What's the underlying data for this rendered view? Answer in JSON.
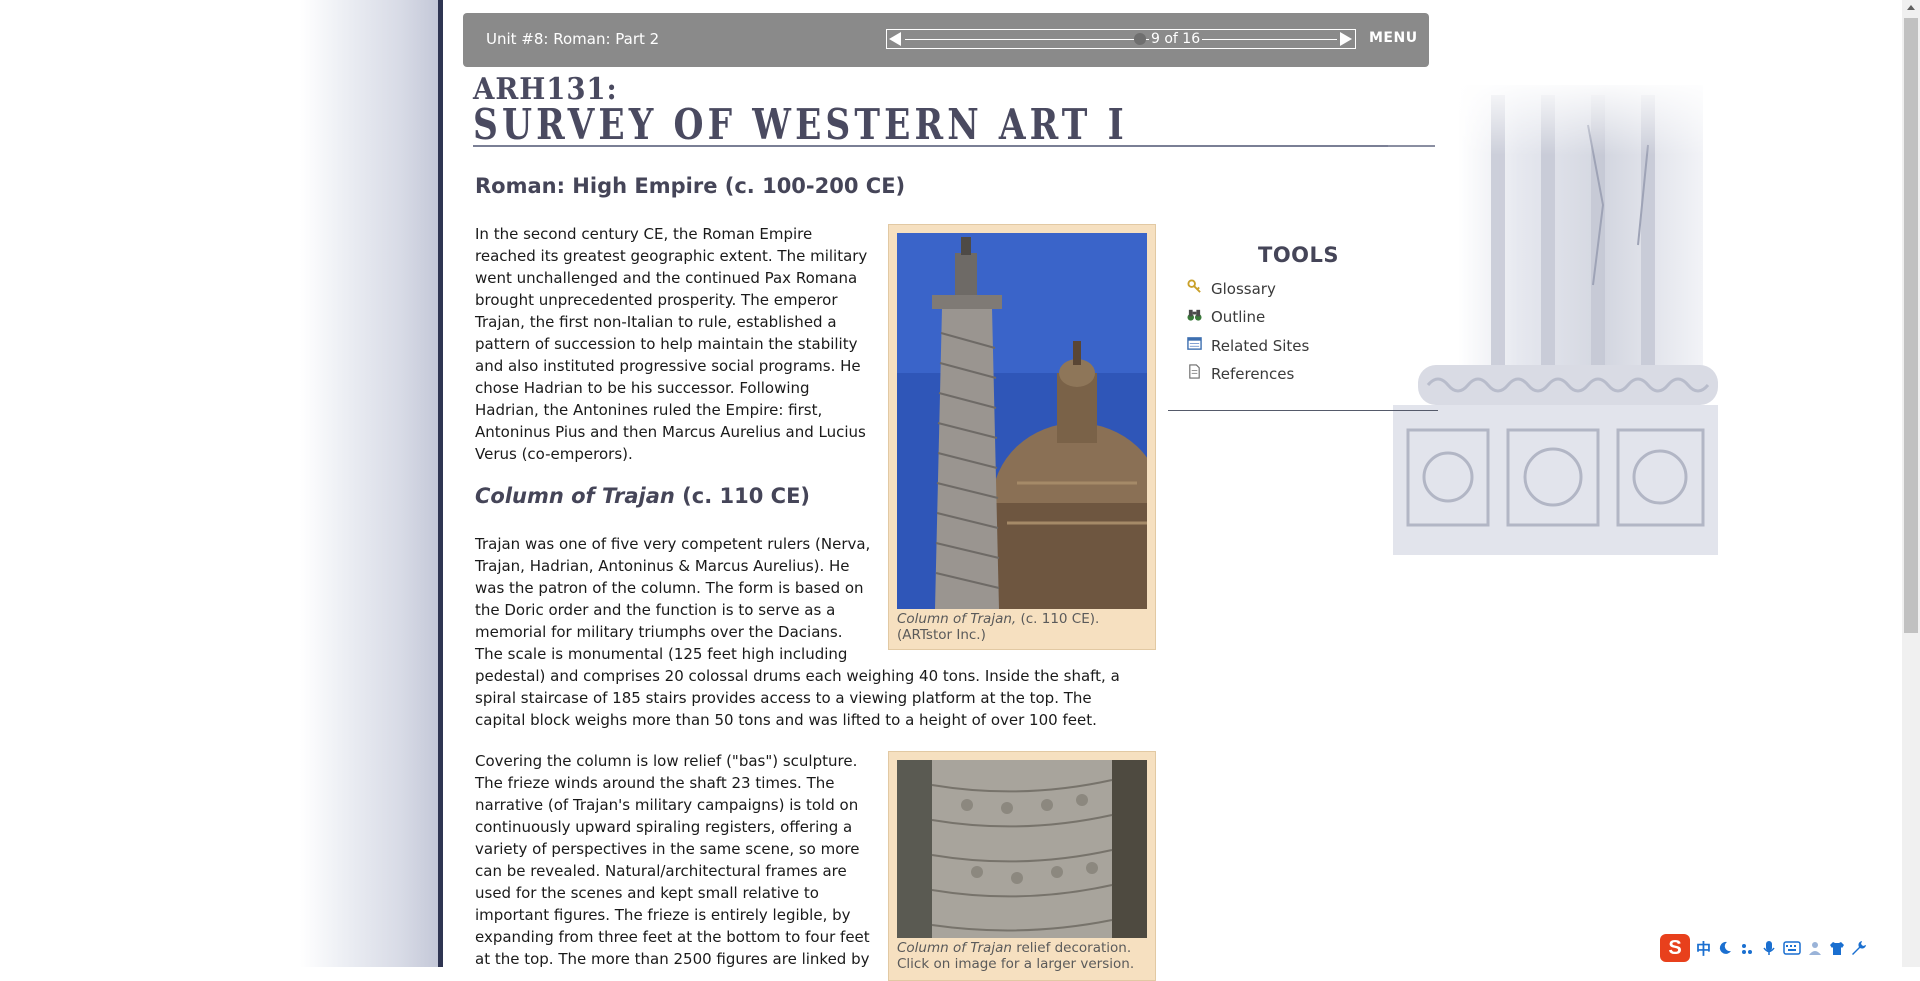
{
  "nav": {
    "unit_title": "Unit #8: Roman: Part 2",
    "pager_text": "9 of 16",
    "menu_label": "MENU"
  },
  "header": {
    "course_code": "ARH131:",
    "course_title": "SURVEY OF WESTERN ART I"
  },
  "main": {
    "section_heading": "Roman: High Empire (c. 100-200 CE)",
    "intro_paragraph": "In the second century CE, the Roman Empire reached its greatest geographic extent. The military went unchallenged and the continued Pax Romana brought unprecedented prosperity. The emperor Trajan, the first non-Italian to rule, established a pattern of succession to help maintain the stability and also instituted progressive social programs. He chose Hadrian to be his successor. Following Hadrian, the Antonines ruled the Empire: first, Antoninus Pius and then Marcus Aurelius and Lucius Verus (co-emperors).",
    "subheading_italic": "Column of Trajan",
    "subheading_rest": " (c. 110 CE)",
    "paragraph_2a": "Trajan was one of five very competent rulers (Nerva, Trajan, Hadrian, Antoninus & Marcus Aurelius). He was the patron of the column. The form is based on the Doric order and the function is to serve as a memorial for military triumphs over the Dacians. The scale is monumental (125 feet high including",
    "paragraph_2b": "pedestal) and comprises 20 colossal drums each weighing 40 tons. Inside the shaft, a spiral staircase of 185 stairs provides access to a viewing platform at the top. The capital block weighs more than 50 tons and was lifted to a height of over 100 feet.",
    "paragraph_3": "Covering the column is low relief (\"bas\") sculpture. The frieze winds around the shaft 23 times. The narrative (of Trajan's military campaigns) is told on continuously upward spiraling registers, offering a variety of perspectives in the same scene, so more can be revealed. Natural/architectural frames are used for the scenes and kept small relative to important figures. The frieze is entirely legible, by expanding from three feet at the bottom to four feet at the top. The more than 2500 figures are linked by"
  },
  "figures": [
    {
      "caption_italic": "Column of Trajan,",
      "caption_rest": " (c. 110 CE). (ARTstor Inc.)"
    },
    {
      "caption_italic": "Column of Trajan",
      "caption_rest": " relief decoration. Click on image for a larger version."
    }
  ],
  "tools": {
    "title": "TOOLS",
    "items": [
      {
        "label": "Glossary",
        "icon": "key-icon"
      },
      {
        "label": "Outline",
        "icon": "binoculars-icon"
      },
      {
        "label": "Related Sites",
        "icon": "browser-window-icon"
      },
      {
        "label": "References",
        "icon": "document-icon"
      }
    ]
  },
  "ime": {
    "logo": "S",
    "mode": "中"
  },
  "colors": {
    "nav_bg": "#8a8a8a",
    "heading": "#454558",
    "figure_bg": "#f6e0c0",
    "left_rule": "#2f3552"
  }
}
